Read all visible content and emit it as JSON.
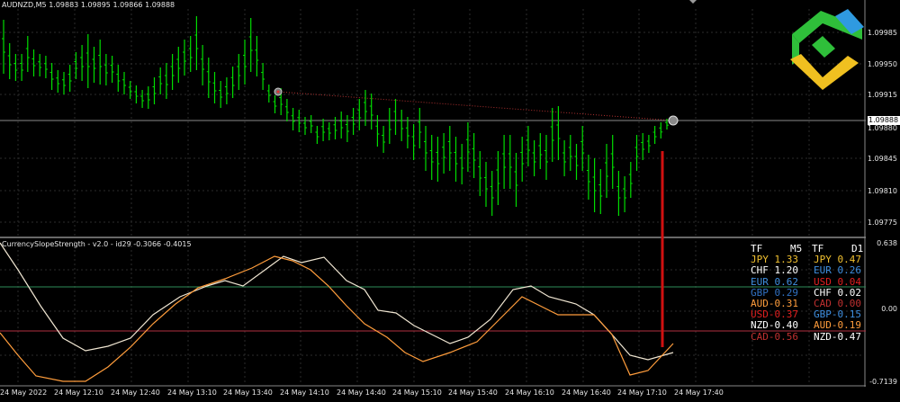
{
  "chart": {
    "symbol_header": "AUDNZD,M5  1.09883 1.09895 1.09866 1.09888",
    "price_axis": [
      "1.09985",
      "1.09950",
      "1.09915",
      "1.09880",
      "1.09845",
      "1.09810",
      "1.09775"
    ],
    "current_price": "1.09888"
  },
  "indicator": {
    "header": "CurrencySlopeStrength - v2.0 - id29 -0.3066 -0.4015",
    "levels": [
      "0.638",
      "0.00",
      "-0.7139"
    ]
  },
  "time_axis": [
    "24 May 2022",
    "24 May 12:10",
    "24 May 12:40",
    "24 May 13:10",
    "24 May 13:40",
    "24 May 14:10",
    "24 May 14:40",
    "24 May 15:10",
    "24 May 15:40",
    "24 May 16:10",
    "24 May 16:40",
    "24 May 17:10",
    "24 May 17:40"
  ],
  "strength_table": {
    "header": {
      "tf1": "TF",
      "m5": "M5",
      "tf2": "TF",
      "d1": "D1"
    },
    "rows": [
      {
        "left": "JPY 1.33",
        "left_color": "#f0c030",
        "right": "JPY 0.47",
        "right_color": "#f0c030"
      },
      {
        "left": "CHF 1.20",
        "left_color": "#ffffff",
        "right": "EUR 0.26",
        "right_color": "#3f8fe0"
      },
      {
        "left": "EUR 0.62",
        "left_color": "#3f8fe0",
        "right": "USD 0.04",
        "right_color": "#e02020"
      },
      {
        "left": "GBP 0.29",
        "left_color": "#3070c0",
        "right": "CHF 0.02",
        "right_color": "#ffffff"
      },
      {
        "left": "AUD-0.31",
        "left_color": "#ff9d3c",
        "right": "CAD 0.00",
        "right_color": "#c03030"
      },
      {
        "left": "USD-0.37",
        "left_color": "#e02020",
        "right": "GBP-0.15",
        "right_color": "#3f8fe0"
      },
      {
        "left": "NZD-0.40",
        "left_color": "#ffffff",
        "right": "AUD-0.19",
        "right_color": "#ff9d3c"
      },
      {
        "left": "CAD-0.56",
        "left_color": "#c03030",
        "right": "NZD-0.47",
        "right_color": "#ffffff"
      }
    ]
  },
  "colors": {
    "background": "#000000",
    "grid": "#2b2b2b",
    "candle": "#00dd00",
    "aud_line": "#ff9d3c",
    "nzd_line": "#f0e6d2",
    "upper_level": "#2e8b57",
    "lower_level": "#b03040",
    "signal_line": "#d01010"
  },
  "icons": [
    "logo-icon",
    "signal-marker-icon"
  ]
}
